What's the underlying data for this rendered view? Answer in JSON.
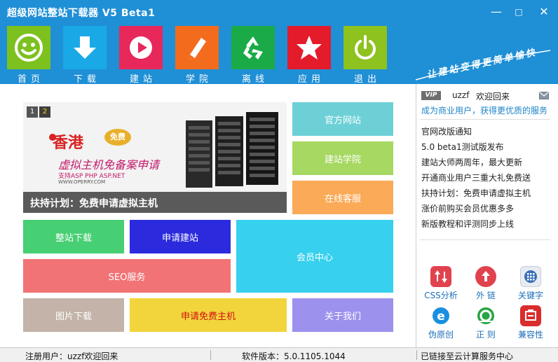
{
  "app": {
    "title": "超级网站整站下载器 V5 Beta1"
  },
  "window_controls": {
    "minimize": "—",
    "maximize": "□",
    "close": "✕"
  },
  "toolbar": [
    {
      "label": "首页",
      "icon": "smiley-icon",
      "color": "#7dc11f"
    },
    {
      "label": "下载",
      "icon": "download-arrow-icon",
      "color": "#19a9e6"
    },
    {
      "label": "建站",
      "icon": "play-circle-icon",
      "color": "#e8275b"
    },
    {
      "label": "学院",
      "icon": "pencil-icon",
      "color": "#f36c1d"
    },
    {
      "label": "离线",
      "icon": "recycle-icon",
      "color": "#1aaa48"
    },
    {
      "label": "应用",
      "icon": "star-icon",
      "color": "#e31b2b"
    },
    {
      "label": "退出",
      "icon": "power-icon",
      "color": "#8dc21f"
    }
  ],
  "slogan": "让建站变得更简单愉快",
  "banner": {
    "dots": [
      "1",
      "2"
    ],
    "active_dot": 1,
    "ad_brand": "香港",
    "ad_badge": "免费",
    "ad_line1": "虚拟主机免备案申请",
    "ad_line2": "支持ASP PHP ASP.NET",
    "ad_line3": "WWW.OPERRY.COM",
    "caption": "扶持计划：免费申请虚拟主机"
  },
  "tiles": {
    "official_site": "官方网站",
    "academy": "建站学院",
    "online_service": "在线客服",
    "site_download": "整站下载",
    "apply_site": "申请建站",
    "member_center": "会员中心",
    "seo": "SEO服务",
    "image_download": "图片下载",
    "free_host": "申请免费主机",
    "about": "关于我们"
  },
  "colors": {
    "official_site": "#6dd0d6",
    "academy": "#a6d862",
    "online_service": "#fbaa58",
    "site_download": "#46cf73",
    "apply_site": "#2b2bdd",
    "member_center": "#37d0ee",
    "seo": "#f27376",
    "image_download": "#c3b3a8",
    "free_host": "#f2d53c",
    "about": "#9c92ee"
  },
  "sidebar": {
    "vip_badge": "VIP",
    "username": "uzzf",
    "welcome": "欢迎回来",
    "upgrade": "成为商业用户，获得更优质的服务",
    "news": [
      "官网改版通知",
      "5.0 beta1测试版发布",
      "建站大师两周年，最大更新",
      "开通商业用户三重大礼免费送",
      "扶持计划：免费申请虚拟主机",
      "涨价前购买会员优惠多多",
      "新版教程和评测同步上线"
    ],
    "tools": [
      {
        "label": "CSS分析",
        "icon": "css-arrows-icon",
        "color": "#e0424e"
      },
      {
        "label": "外 链",
        "icon": "upload-cloud-icon",
        "color": "#e0424e"
      },
      {
        "label": "关键字",
        "icon": "keypad-icon",
        "color": "#3a6fb5"
      },
      {
        "label": "伪原创",
        "icon": "ie-browser-icon",
        "color": "#1a8fe0"
      },
      {
        "label": "正 则",
        "icon": "regex-circle-icon",
        "color": "#27a544"
      },
      {
        "label": "兼容性",
        "icon": "compat-box-icon",
        "color": "#d92c2c"
      }
    ]
  },
  "statusbar": {
    "user": "注册用户：uzzf欢迎回来",
    "version": "软件版本：5.0.1105.1044",
    "connection": "已链接至云计算服务中心"
  }
}
